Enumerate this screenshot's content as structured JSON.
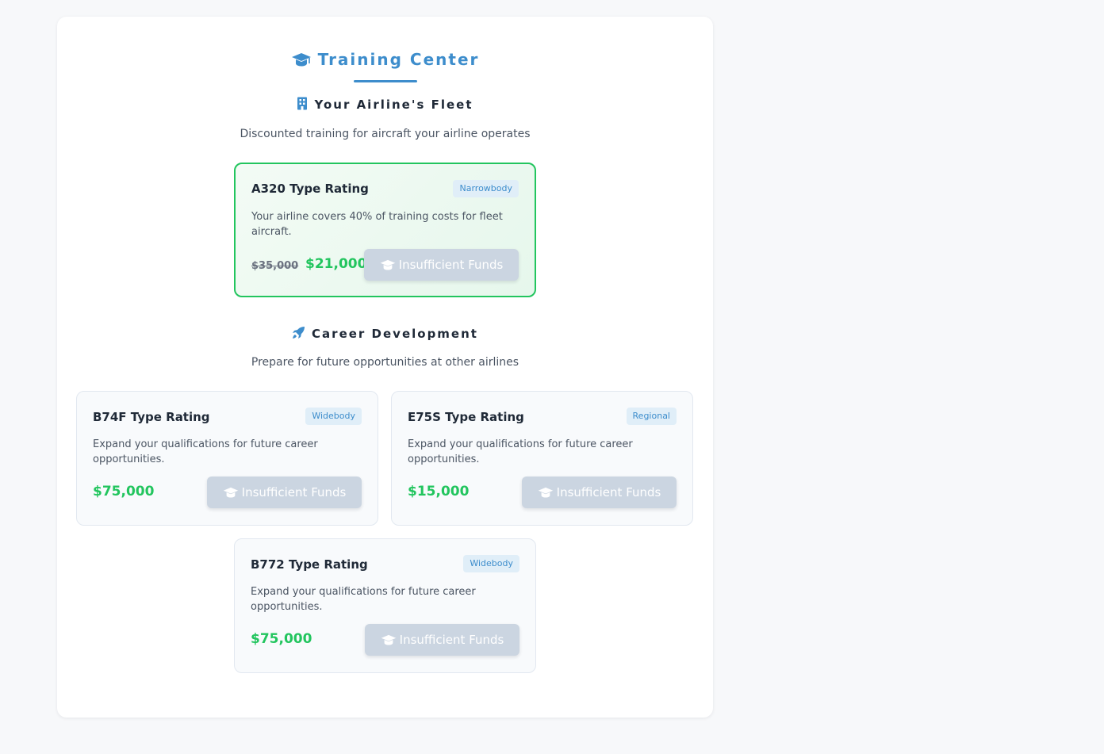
{
  "header": {
    "title": "Training Center",
    "icon": "graduation-cap-icon",
    "accent_color": "#3d8dcc"
  },
  "fleet_section": {
    "heading": "Your Airline's Fleet",
    "icon": "building-icon",
    "subtitle": "Discounted training for aircraft your airline operates",
    "cards": [
      {
        "title": "A320 Type Rating",
        "badge": "Narrowbody",
        "description": "Your airline covers 40% of training costs for fleet aircraft.",
        "original_price": "$35,000",
        "price": "$21,000",
        "button_label": "Insufficient Funds",
        "border_color": "#22c55e"
      }
    ]
  },
  "career_section": {
    "heading": "Career Development",
    "icon": "rocket-icon",
    "subtitle": "Prepare for future opportunities at other airlines",
    "cards": [
      {
        "title": "B74F Type Rating",
        "badge": "Widebody",
        "description": "Expand your qualifications for future career opportunities.",
        "price": "$75,000",
        "button_label": "Insufficient Funds"
      },
      {
        "title": "E75S Type Rating",
        "badge": "Regional",
        "description": "Expand your qualifications for future career opportunities.",
        "price": "$15,000",
        "button_label": "Insufficient Funds"
      },
      {
        "title": "B772 Type Rating",
        "badge": "Widebody",
        "description": "Expand your qualifications for future career opportunities.",
        "price": "$75,000",
        "button_label": "Insufficient Funds"
      }
    ]
  },
  "colors": {
    "price_green": "#22c55e",
    "disabled_button": "#cbd5e1",
    "badge_background": "#e0eef8"
  }
}
